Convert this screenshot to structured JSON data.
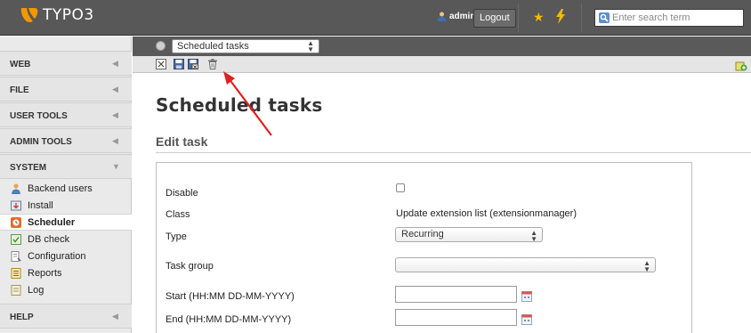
{
  "app": {
    "logo_text": "TYPO3"
  },
  "topbar": {
    "username": "admin",
    "logout_label": "Logout",
    "search_placeholder": "Enter search term",
    "brand_color": "#f49700"
  },
  "sidebar": {
    "sections": [
      {
        "label": "WEB",
        "chevron": "◀"
      },
      {
        "label": "FILE",
        "chevron": "◀"
      },
      {
        "label": "USER TOOLS",
        "chevron": "◀"
      },
      {
        "label": "ADMIN TOOLS",
        "chevron": "◀"
      },
      {
        "label": "SYSTEM",
        "chevron": "▼"
      },
      {
        "label": "HELP",
        "chevron": "◀"
      }
    ],
    "system_items": [
      {
        "label": "Backend users",
        "icon": "backend-users-icon"
      },
      {
        "label": "Install",
        "icon": "install-icon"
      },
      {
        "label": "Scheduler",
        "icon": "scheduler-icon",
        "active": true
      },
      {
        "label": "DB check",
        "icon": "db-check-icon"
      },
      {
        "label": "Configuration",
        "icon": "configuration-icon"
      },
      {
        "label": "Reports",
        "icon": "reports-icon"
      },
      {
        "label": "Log",
        "icon": "log-icon"
      }
    ]
  },
  "docheader": {
    "module_select_value": "Scheduled tasks",
    "toolbar_icons": [
      "close-icon",
      "save-icon",
      "save-and-close-icon",
      "delete-icon"
    ]
  },
  "content": {
    "page_title": "Scheduled tasks",
    "section_title": "Edit task",
    "form": {
      "disable_label": "Disable",
      "class_label": "Class",
      "class_value": "Update extension list (extensionmanager)",
      "type_label": "Type",
      "type_value": "Recurring",
      "task_group_label": "Task group",
      "task_group_value": "",
      "start_label": "Start (HH:MM DD-MM-YYYY)",
      "end_label": "End (HH:MM DD-MM-YYYY)"
    }
  },
  "annotation": {
    "arrow_color": "#e02020"
  }
}
